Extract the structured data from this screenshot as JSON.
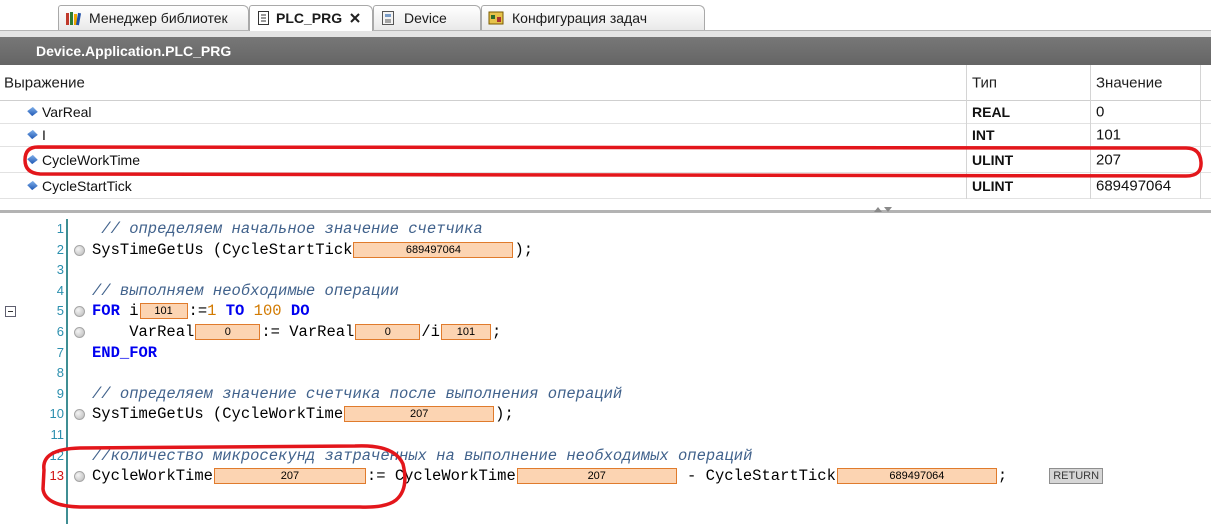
{
  "tabs": [
    {
      "label": "Менеджер библиотек",
      "icon": "library-manager-icon",
      "active": false
    },
    {
      "label": "PLC_PRG",
      "icon": "pou-document-icon",
      "active": true
    },
    {
      "label": "Device",
      "icon": "device-icon",
      "active": false
    },
    {
      "label": "Конфигурация задач",
      "icon": "task-configuration-icon",
      "active": false
    }
  ],
  "title_bar": "Device.Application.PLC_PRG",
  "watch": {
    "columns": {
      "expression": "Выражение",
      "type": "Тип",
      "value": "Значение"
    },
    "rows": [
      {
        "name": "VarReal",
        "type": "REAL",
        "value": "0"
      },
      {
        "name": "I",
        "type": "INT",
        "value": "101"
      },
      {
        "name": "CycleWorkTime",
        "type": "ULINT",
        "value": "207"
      },
      {
        "name": "CycleStartTick",
        "type": "ULINT",
        "value": "689497064"
      }
    ]
  },
  "code": {
    "lines": [
      {
        "n": "1",
        "marker": false,
        "tokens": [
          {
            "k": "cm",
            "s": " // определяем начальное значение счетчика"
          }
        ]
      },
      {
        "n": "2",
        "marker": true,
        "tokens": [
          {
            "k": "id",
            "s": "SysTimeGetUs (CycleStartTick"
          },
          {
            "k": "val",
            "s": "689497064"
          },
          {
            "k": "id",
            "s": ");"
          }
        ]
      },
      {
        "n": "3",
        "marker": false,
        "tokens": []
      },
      {
        "n": "4",
        "marker": false,
        "tokens": [
          {
            "k": "cm",
            "s": "// выполняем необходимые операции"
          }
        ]
      },
      {
        "n": "5",
        "marker": true,
        "fold": true,
        "tokens": [
          {
            "k": "kw",
            "s": "FOR"
          },
          {
            "k": "id",
            "s": " i"
          },
          {
            "k": "val",
            "s": "101"
          },
          {
            "k": "id",
            "s": ":="
          },
          {
            "k": "num",
            "s": "1"
          },
          {
            "k": "id",
            "s": " "
          },
          {
            "k": "kw",
            "s": "TO"
          },
          {
            "k": "id",
            "s": " "
          },
          {
            "k": "num",
            "s": "100"
          },
          {
            "k": "id",
            "s": " "
          },
          {
            "k": "kw",
            "s": "DO"
          }
        ]
      },
      {
        "n": "6",
        "marker": true,
        "tokens": [
          {
            "k": "id",
            "s": "    VarReal"
          },
          {
            "k": "val",
            "s": "0"
          },
          {
            "k": "id",
            "s": ":= VarReal"
          },
          {
            "k": "val",
            "s": "0"
          },
          {
            "k": "id",
            "s": "/i"
          },
          {
            "k": "val",
            "s": "101"
          },
          {
            "k": "id",
            "s": ";"
          }
        ]
      },
      {
        "n": "7",
        "marker": false,
        "tokens": [
          {
            "k": "kw",
            "s": "END_FOR"
          }
        ]
      },
      {
        "n": "8",
        "marker": false,
        "tokens": []
      },
      {
        "n": "9",
        "marker": false,
        "tokens": [
          {
            "k": "cm",
            "s": "// определяем значение счетчика после выполнения операций"
          }
        ]
      },
      {
        "n": "10",
        "marker": true,
        "tokens": [
          {
            "k": "id",
            "s": "SysTimeGetUs (CycleWorkTime"
          },
          {
            "k": "val",
            "s": "207"
          },
          {
            "k": "id",
            "s": ");"
          }
        ]
      },
      {
        "n": "11",
        "marker": false,
        "tokens": []
      },
      {
        "n": "12",
        "marker": false,
        "tokens": [
          {
            "k": "cm",
            "s": "//количество микросекунд затраченных на выполнение необходимых операций"
          }
        ]
      },
      {
        "n": "13",
        "marker": true,
        "tokens": [
          {
            "k": "id",
            "s": "CycleWorkTime"
          },
          {
            "k": "val",
            "s": "207"
          },
          {
            "k": "id",
            "s": ":= CycleWorkTime"
          },
          {
            "k": "val",
            "s": "207"
          },
          {
            "k": "id",
            "s": " - CycleStartTick"
          },
          {
            "k": "val",
            "s": "689497064"
          },
          {
            "k": "id",
            "s": ";"
          },
          {
            "k": "ret",
            "s": "RETURN"
          }
        ]
      }
    ]
  },
  "colors": {
    "monitor_value_bg": "#fcd4b2",
    "monitor_value_border": "#e07b2c",
    "annotation_red": "#e3161b",
    "title_bar_bg": "#6b6b6b",
    "keyword": "#0000f0",
    "comment": "#41628c"
  }
}
